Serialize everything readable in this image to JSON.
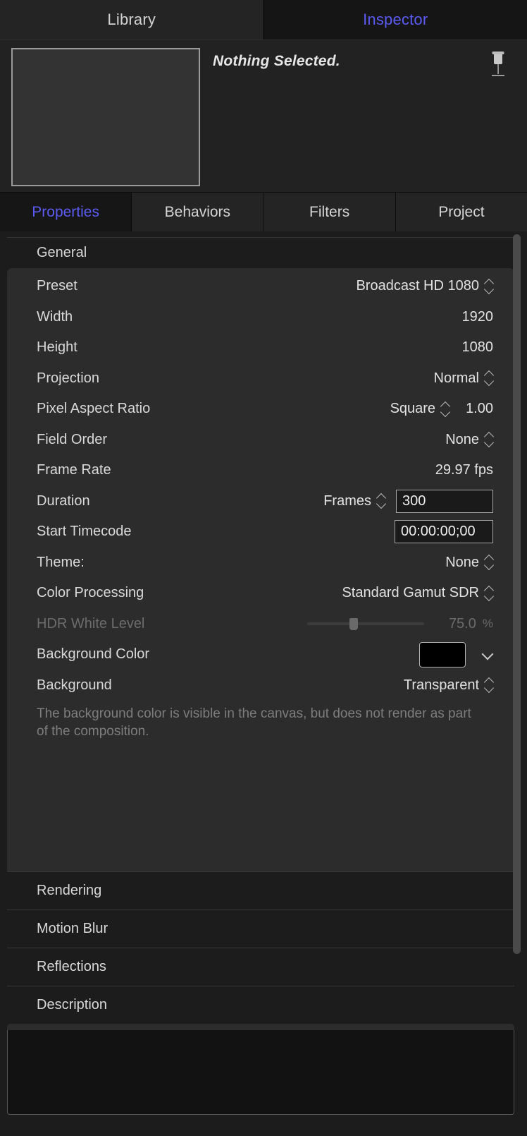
{
  "window": {
    "top_tabs": [
      {
        "label": "Library",
        "active": false
      },
      {
        "label": "Inspector",
        "active": true
      }
    ]
  },
  "header": {
    "status_text": "Nothing Selected.",
    "pin_icon": "pushpin-icon",
    "thumbnail": "empty-preview-thumbnail"
  },
  "inspector_tabs": [
    {
      "label": "Properties",
      "active": true
    },
    {
      "label": "Behaviors",
      "active": false
    },
    {
      "label": "Filters",
      "active": false
    },
    {
      "label": "Project",
      "active": false
    }
  ],
  "general": {
    "title": "General",
    "rows": [
      {
        "label": "Preset",
        "value": "Broadcast HD 1080",
        "control": "popup"
      },
      {
        "label": "Width",
        "value": "1920",
        "control": "text"
      },
      {
        "label": "Height",
        "value": "1080",
        "control": "text"
      },
      {
        "label": "Projection",
        "value": "Normal",
        "control": "popup"
      },
      {
        "label": "Pixel Aspect Ratio",
        "value": "Square",
        "control": "popup",
        "extra": "1.00"
      },
      {
        "label": "Field Order",
        "value": "None",
        "control": "popup"
      },
      {
        "label": "Frame Rate",
        "value": "29.97 fps",
        "control": "text"
      },
      {
        "label": "Duration",
        "value": "Frames",
        "control": "popup-field",
        "field_value": "300"
      },
      {
        "label": "Start Timecode",
        "value": "",
        "control": "field",
        "field_value": "00:00:00;00"
      },
      {
        "label": "Theme:",
        "value": "None",
        "control": "popup"
      },
      {
        "label": "Color Processing",
        "value": "Standard Gamut SDR",
        "control": "popup"
      },
      {
        "label": "HDR White Level",
        "value": "75.0",
        "control": "slider",
        "units": "%",
        "disabled": true,
        "slider_percent": 36
      },
      {
        "label": "Background Color",
        "value": "",
        "control": "color",
        "swatch_color": "#000000"
      },
      {
        "label": "Background",
        "value": "Transparent",
        "control": "popup"
      }
    ],
    "note": "The background color is visible in the canvas, but does not render as part of the composition."
  },
  "sections": [
    {
      "label": "Rendering"
    },
    {
      "label": "Motion Blur"
    },
    {
      "label": "Reflections"
    },
    {
      "label": "Description"
    }
  ],
  "description": {
    "textarea_value": "",
    "placeholder": ""
  },
  "colors": {
    "accent": "#5b5bf3",
    "panel": "#2c2c2c",
    "background": "#1c1c1c",
    "text": "#d9d9d9",
    "dim_text": "#6c6c6c"
  }
}
